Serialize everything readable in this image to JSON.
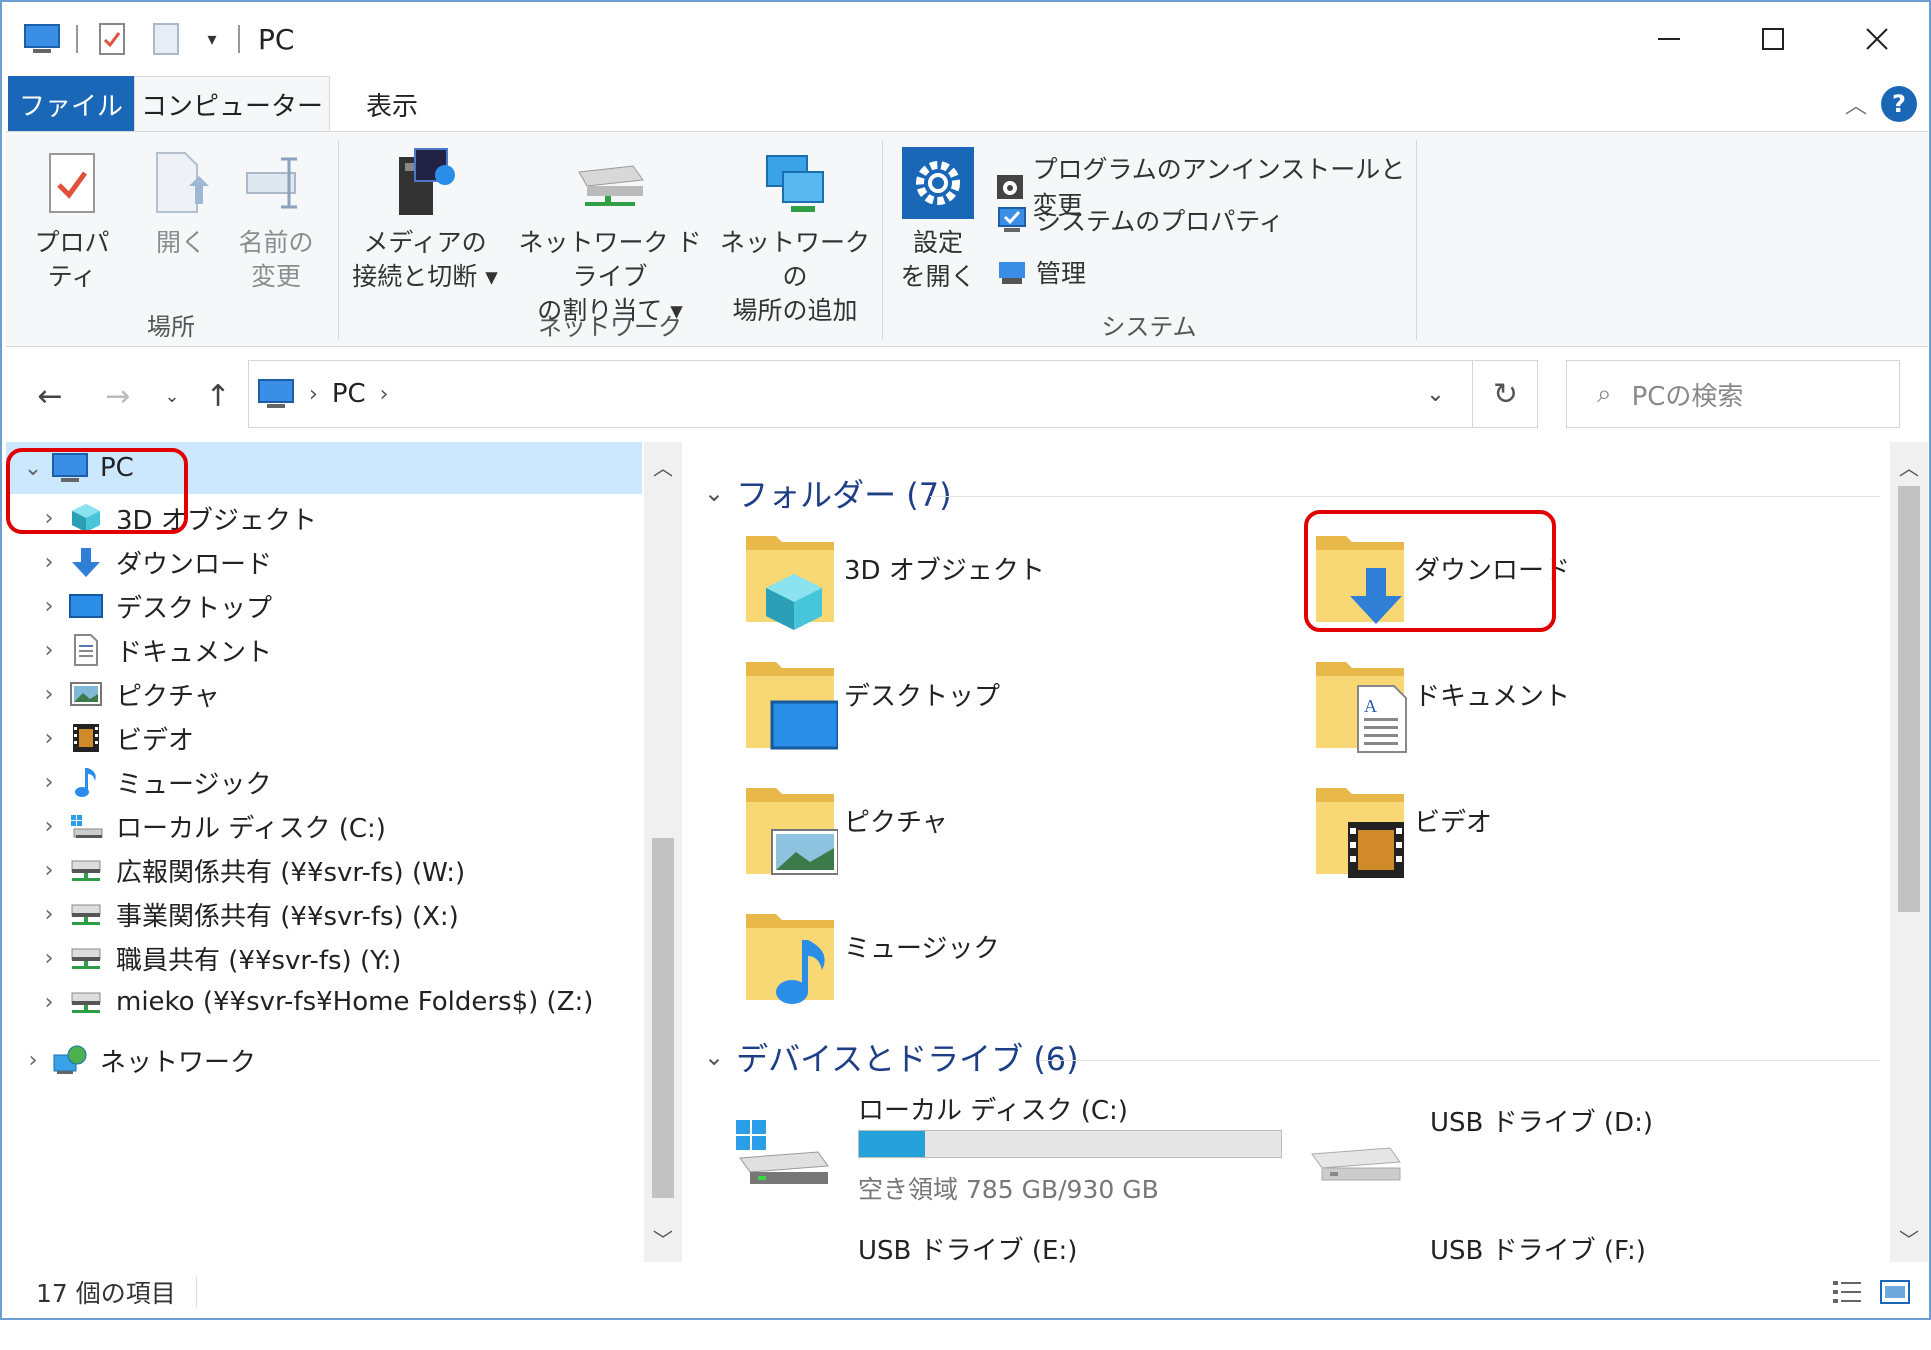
{
  "window": {
    "title": "PC"
  },
  "tabs": {
    "file": "ファイル",
    "computer": "コンピューター",
    "view": "表示"
  },
  "ribbon": {
    "location": {
      "label": "場所",
      "properties": "プロパティ",
      "open": "開く",
      "rename_line1": "名前の",
      "rename_line2": "変更"
    },
    "network": {
      "label": "ネットワーク",
      "media_line1": "メディアの",
      "media_line2": "接続と切断",
      "mapdrive_line1": "ネットワーク ドライブ",
      "mapdrive_line2": "の割り当て",
      "addloc_line1": "ネットワークの",
      "addloc_line2": "場所の追加"
    },
    "system": {
      "label": "システム",
      "settings_line1": "設定",
      "settings_line2": "を開く",
      "uninstall": "プログラムのアンインストールと変更",
      "sysprops": "システムのプロパティ",
      "manage": "管理"
    }
  },
  "address": {
    "crumb": "PC",
    "search_placeholder": "PCの検索"
  },
  "nav_tree": [
    {
      "label": "PC",
      "icon": "pc-icon",
      "level": 0,
      "selected": true,
      "expanded": true
    },
    {
      "label": "3D オブジェクト",
      "icon": "3d-objects-icon",
      "level": 1
    },
    {
      "label": "ダウンロード",
      "icon": "download-icon",
      "level": 1
    },
    {
      "label": "デスクトップ",
      "icon": "desktop-icon",
      "level": 1
    },
    {
      "label": "ドキュメント",
      "icon": "document-icon",
      "level": 1
    },
    {
      "label": "ピクチャ",
      "icon": "picture-icon",
      "level": 1
    },
    {
      "label": "ビデオ",
      "icon": "video-icon",
      "level": 1
    },
    {
      "label": "ミュージック",
      "icon": "music-icon",
      "level": 1
    },
    {
      "label": "ローカル ディスク (C:)",
      "icon": "local-disk-icon",
      "level": 1
    },
    {
      "label": "広報関係共有 (¥¥svr-fs) (W:)",
      "icon": "network-drive-icon",
      "level": 1
    },
    {
      "label": "事業関係共有 (¥¥svr-fs) (X:)",
      "icon": "network-drive-icon",
      "level": 1
    },
    {
      "label": "職員共有 (¥¥svr-fs) (Y:)",
      "icon": "network-drive-icon",
      "level": 1
    },
    {
      "label": "mieko (¥¥svr-fs¥Home Folders$) (Z:)",
      "icon": "network-drive-icon",
      "level": 1
    },
    {
      "label": "ネットワーク",
      "icon": "network-icon",
      "level": 0
    }
  ],
  "content": {
    "folders_header": "フォルダー (7)",
    "folders": [
      {
        "name": "3D オブジェクト",
        "icon": "3d-objects-folder-icon"
      },
      {
        "name": "ダウンロード",
        "icon": "downloads-folder-icon"
      },
      {
        "name": "デスクトップ",
        "icon": "desktop-folder-icon"
      },
      {
        "name": "ドキュメント",
        "icon": "documents-folder-icon"
      },
      {
        "name": "ピクチャ",
        "icon": "pictures-folder-icon"
      },
      {
        "name": "ビデオ",
        "icon": "videos-folder-icon"
      },
      {
        "name": "ミュージック",
        "icon": "music-folder-icon"
      }
    ],
    "drives_header": "デバイスとドライブ (6)",
    "drives": [
      {
        "name": "ローカル ディスク (C:)",
        "free": "空き領域 785 GB/930 GB",
        "used_fraction": 0.156,
        "icon": "windows-drive-icon"
      },
      {
        "name": "USB ドライブ (D:)",
        "icon": "usb-drive-icon"
      },
      {
        "name": "USB ドライブ (E:)",
        "icon": "usb-drive-icon"
      },
      {
        "name": "USB ドライブ (F:)",
        "icon": "usb-drive-icon"
      }
    ]
  },
  "status": {
    "items": "17 個の項目"
  },
  "colors": {
    "accent": "#1a66b7",
    "selection": "#cce8ff",
    "highlight": "#e00000",
    "folder": "#f8d775",
    "progress": "#26a0da"
  }
}
